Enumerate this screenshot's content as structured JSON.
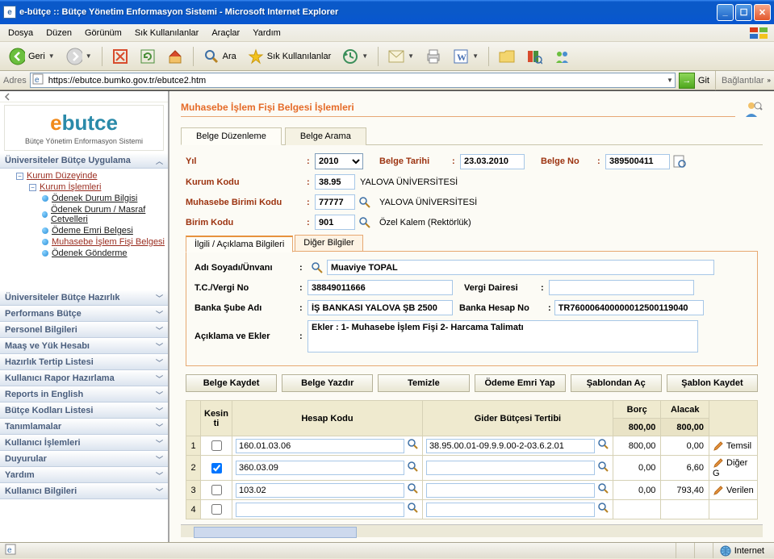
{
  "window": {
    "title": "e-bütçe :: Bütçe Yönetim Enformasyon Sistemi - Microsoft Internet Explorer"
  },
  "menubar": {
    "items": [
      "Dosya",
      "Düzen",
      "Görünüm",
      "Sık Kullanılanlar",
      "Araçlar",
      "Yardım"
    ]
  },
  "toolbar": {
    "back": "Geri",
    "search": "Ara",
    "favorites": "Sık Kullanılanlar"
  },
  "addressbar": {
    "label": "Adres",
    "url": "https://ebutce.bumko.gov.tr/ebutce2.htm",
    "go": "Git",
    "links": "Bağlantılar"
  },
  "logo": {
    "subtext": "Bütçe Yönetim Enformasyon Sistemi"
  },
  "sidebar": {
    "panel_open": "Üniversiteler Bütçe Uygulama",
    "tree": {
      "n0": "Kurum Düzeyinde",
      "n1": "Kurum İşlemleri",
      "n2": "Ödenek Durum Bilgisi",
      "n3": "Ödenek Durum / Masraf Cetvelleri",
      "n4": "Ödeme Emri Belgesi",
      "n5": "Muhasebe İşlem Fişi Belgesi",
      "n6": "Ödenek Gönderme"
    },
    "panels": [
      "Üniversiteler Bütçe Hazırlık",
      "Performans Bütçe",
      "Personel Bilgileri",
      "Maaş ve Yük Hesabı",
      "Hazırlık Tertip Listesi",
      "Kullanıcı Rapor Hazırlama",
      "Reports in English",
      "Bütçe Kodları Listesi",
      "Tanımlamalar",
      "Kullanıcı İşlemleri",
      "Duyurular",
      "Yardım",
      "Kullanıcı Bilgileri"
    ]
  },
  "page": {
    "title": "Muhasebe İşlem Fişi Belgesi İşlemleri",
    "tabs": [
      "Belge Düzenleme",
      "Belge Arama"
    ],
    "form": {
      "yil_label": "Yıl",
      "yil_value": "2010",
      "belge_tarihi_label": "Belge Tarihi",
      "belge_tarihi_value": "23.03.2010",
      "belge_no_label": "Belge No",
      "belge_no_value": "389500411",
      "kurum_kodu_label": "Kurum Kodu",
      "kurum_kodu_value": "38.95",
      "kurum_text": "YALOVA ÜNİVERSİTESİ",
      "muhasebe_birimi_label": "Muhasebe Birimi Kodu",
      "muhasebe_birimi_value": "77777",
      "muhasebe_text": "YALOVA ÜNİVERSİTESİ",
      "birim_kodu_label": "Birim Kodu",
      "birim_kodu_value": "901",
      "birim_text": "Özel Kalem (Rektörlük)"
    },
    "sub_tabs": [
      "İlgili / Açıklama Bilgileri",
      "Diğer Bilgiler"
    ],
    "person": {
      "adi_label": "Adı Soyadı/Ünvanı",
      "adi_value": "Muaviye TOPAL",
      "tc_label": "T.C./Vergi No",
      "tc_value": "38849011666",
      "vergi_dairesi_label": "Vergi Dairesi",
      "vergi_dairesi_value": "",
      "banka_sube_label": "Banka Şube Adı",
      "banka_sube_value": "İŞ BANKASI YALOVA ŞB 2500",
      "banka_hesap_label": "Banka Hesap No",
      "banka_hesap_value": "TR760006400000012500119040",
      "aciklama_label": "Açıklama ve Ekler",
      "aciklama_value": "Ekler : 1- Muhasebe İşlem Fişi 2- Harcama Talimatı"
    },
    "buttons": {
      "kaydet": "Belge Kaydet",
      "yazdir": "Belge Yazdır",
      "temizle": "Temizle",
      "odeme": "Ödeme Emri Yap",
      "sablon_ac": "Şablondan Aç",
      "sablon_kaydet": "Şablon Kaydet"
    },
    "grid": {
      "col_kesinti": "Kesin ti",
      "col_hesap": "Hesap Kodu",
      "col_gider": "Gider Bütçesi Tertibi",
      "col_borc": "Borç",
      "col_alacak": "Alacak",
      "tot_borc": "800,00",
      "tot_alacak": "800,00",
      "rows": [
        {
          "n": "1",
          "chk": false,
          "hesap": "160.01.03.06",
          "gider": "38.95.00.01-09.9.9.00-2-03.6.2.01",
          "borc": "800,00",
          "alacak": "0,00",
          "desc": "Temsil"
        },
        {
          "n": "2",
          "chk": true,
          "hesap": "360.03.09",
          "gider": "",
          "borc": "0,00",
          "alacak": "6,60",
          "desc": "Diğer G"
        },
        {
          "n": "3",
          "chk": false,
          "hesap": "103.02",
          "gider": "",
          "borc": "0,00",
          "alacak": "793,40",
          "desc": "Verilen"
        },
        {
          "n": "4",
          "chk": false,
          "hesap": "",
          "gider": "",
          "borc": "",
          "alacak": "",
          "desc": ""
        }
      ]
    }
  },
  "statusbar": {
    "internet": "Internet"
  }
}
